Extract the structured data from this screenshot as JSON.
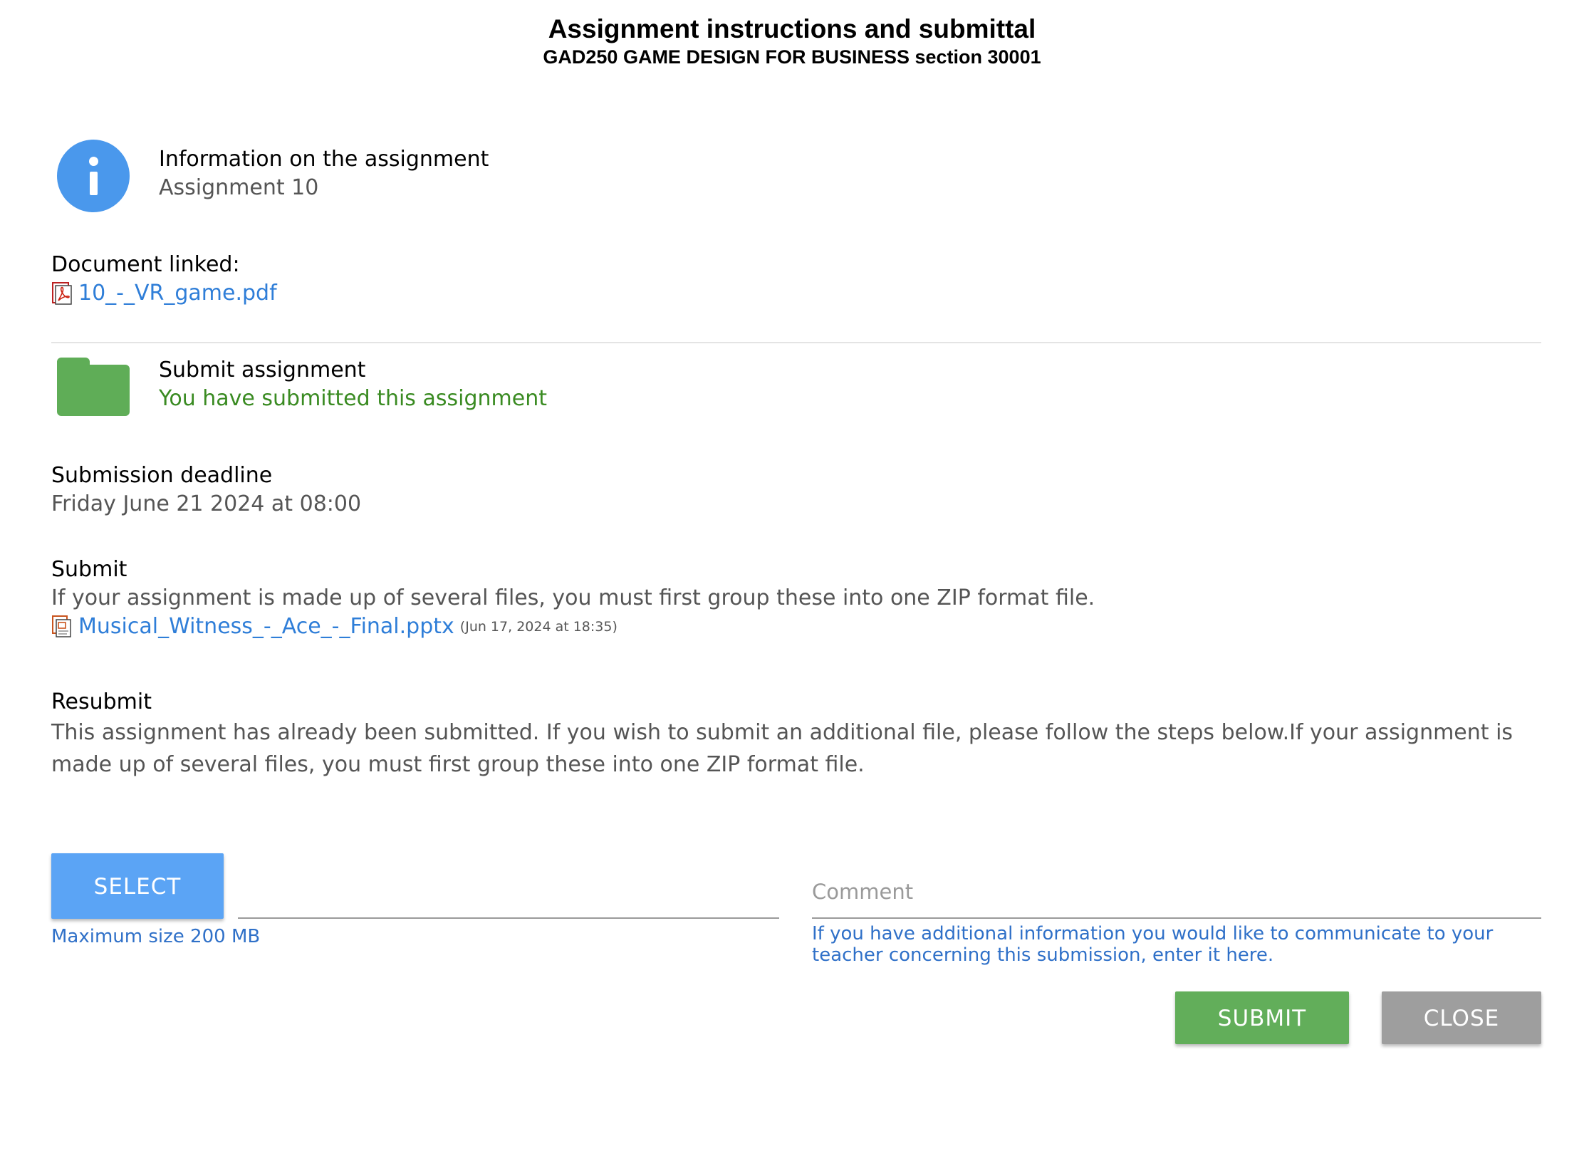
{
  "header": {
    "title": "Assignment instructions and submittal",
    "subtitle": "GAD250 GAME DESIGN FOR BUSINESS section 30001"
  },
  "info": {
    "icon": "info-icon",
    "heading": "Information on the assignment",
    "value": "Assignment 10"
  },
  "document": {
    "label": "Document linked:",
    "file_icon": "pdf-file-icon",
    "file_name": "10_-_VR_game.pdf"
  },
  "submit_status": {
    "icon": "folder-icon",
    "heading": "Submit assignment",
    "status": "You have submitted this assignment",
    "status_color": "#3a8b22"
  },
  "deadline": {
    "label": "Submission deadline",
    "value": "Friday June 21 2024 at 08:00"
  },
  "submit_section": {
    "label": "Submit",
    "instructions": "If your assignment is made up of several files, you must first group these into one ZIP format file.",
    "file_icon": "pptx-file-icon",
    "file_name": "Musical_Witness_-_Ace_-_Final.pptx",
    "file_date": "(Jun 17, 2024 at 18:35)"
  },
  "resubmit": {
    "label": "Resubmit",
    "text": "This assignment has already been submitted. If you wish to submit an additional file, please follow the steps below.If your assignment is made up of several files, you must first group these into one ZIP format file."
  },
  "upload": {
    "select_label": "SELECT",
    "max_size": "Maximum size 200 MB",
    "comment_placeholder": "Comment",
    "comment_value": "",
    "comment_hint": "If you have additional information you would like to communicate to your teacher concerning this submission, enter it here."
  },
  "actions": {
    "submit_label": "SUBMIT",
    "close_label": "CLOSE"
  },
  "colors": {
    "accent_blue": "#5ba4f5",
    "link_blue": "#2f7ed8",
    "success_green": "#62ae5a",
    "close_gray": "#9e9e9e"
  }
}
